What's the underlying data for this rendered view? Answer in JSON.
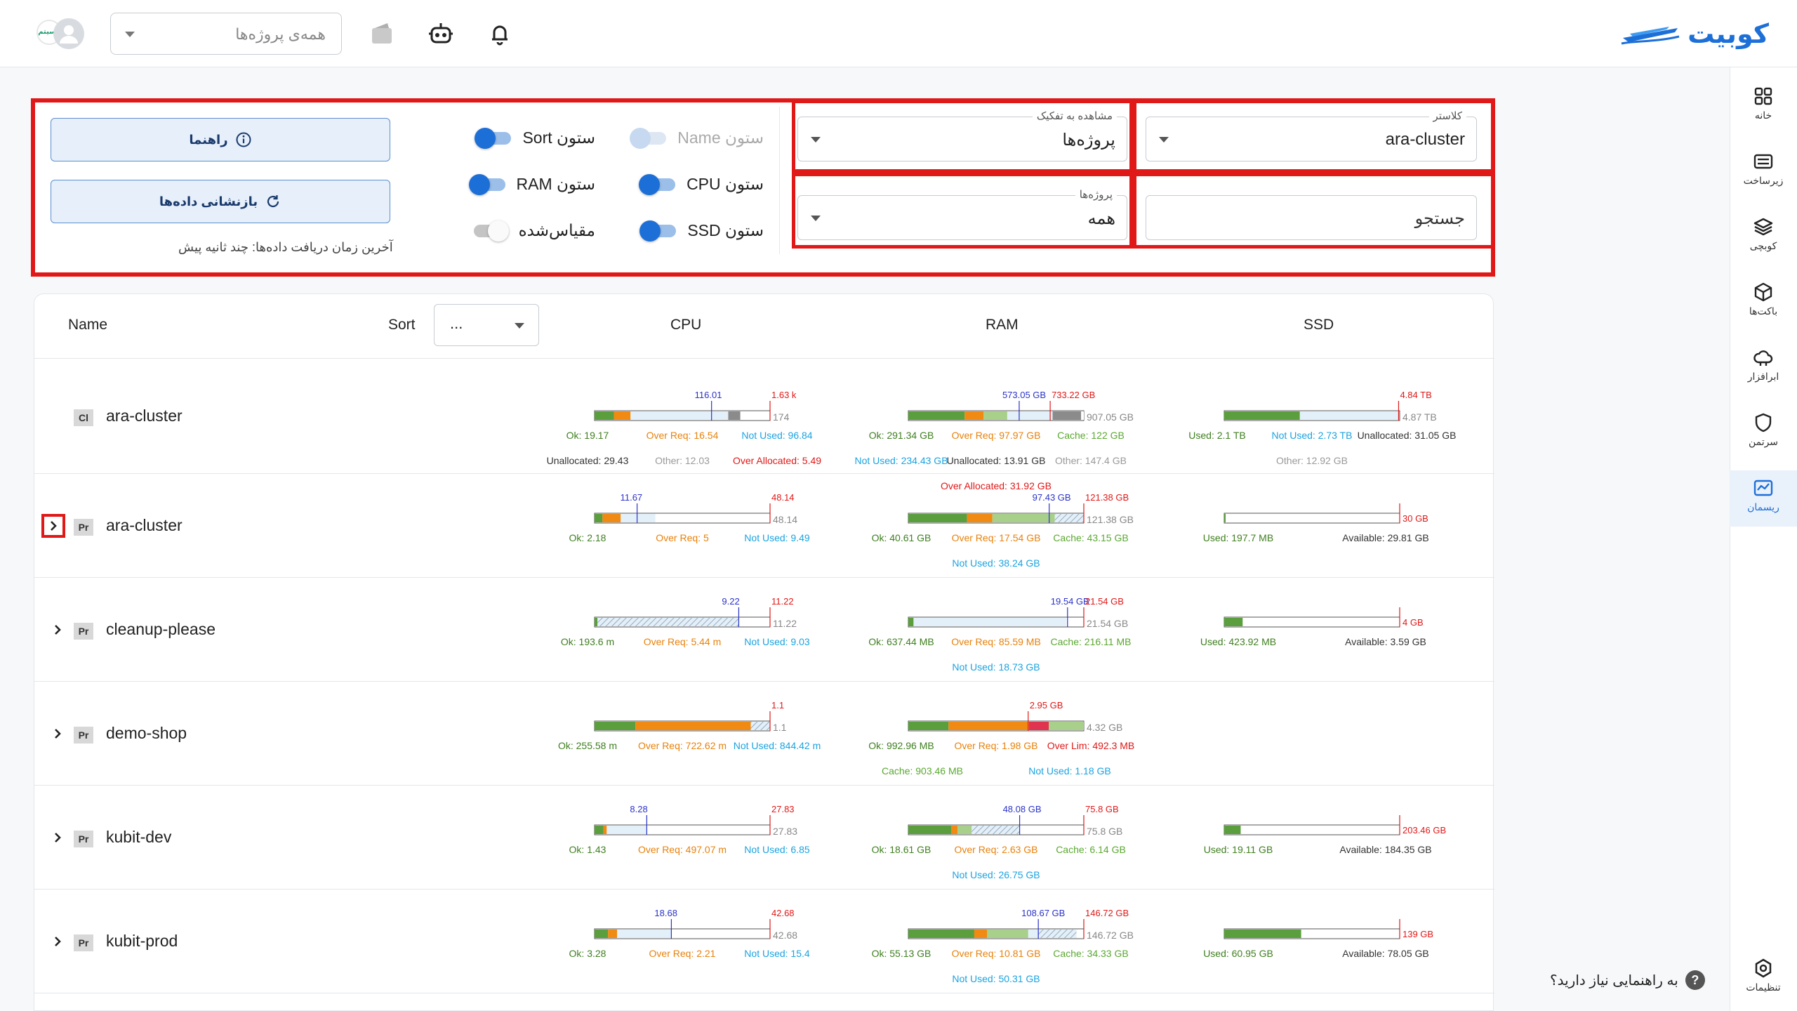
{
  "app": {
    "logo_text": "کوبیت",
    "project_select_placeholder": "همه‌ی پروژه‌ها",
    "avatar_brand": "رسیتم"
  },
  "sidenav": [
    {
      "label": "خانه",
      "icon": "grid-icon"
    },
    {
      "label": "زیرساخت",
      "icon": "server-icon"
    },
    {
      "label": "کوبچی",
      "icon": "layers-icon"
    },
    {
      "label": "باکت‌ها",
      "icon": "box-icon"
    },
    {
      "label": "ابرافزار",
      "icon": "cloud-icon"
    },
    {
      "label": "سرتمن",
      "icon": "shield-icon"
    },
    {
      "label": "ریسمان",
      "icon": "chart-icon",
      "active": true
    }
  ],
  "settings_label": "تنظیمات",
  "help_text": "به راهنمایی نیاز دارید؟",
  "filters": {
    "cluster": {
      "label": "کلاستر",
      "value": "ara-cluster"
    },
    "breakdown": {
      "label": "مشاهده به تفکیک",
      "value": "پروژه‌ها"
    },
    "search": {
      "placeholder": "جستجو"
    },
    "projects": {
      "label": "پروژه‌ها",
      "value": "همه"
    }
  },
  "toggles": [
    {
      "label": "ستون Name",
      "on": true,
      "disabled": true
    },
    {
      "label": "ستون Sort",
      "on": true
    },
    {
      "label": "ستون CPU",
      "on": true
    },
    {
      "label": "ستون RAM",
      "on": true
    },
    {
      "label": "ستون SSD",
      "on": true
    },
    {
      "label": "مقیاس‌شده",
      "on": false
    }
  ],
  "buttons": {
    "guide": "راهنما",
    "reset": "بازنشانی داده‌ها"
  },
  "last_fetch": "آخرین زمان دریافت داده‌ها: چند ثانیه پیش",
  "table": {
    "headers": {
      "name": "Name",
      "sort": "Sort",
      "cpu": "CPU",
      "ram": "RAM",
      "ssd": "SSD"
    },
    "sort_value": "...",
    "rows": [
      {
        "badge": "Cl",
        "name": "ara-cluster",
        "expandable": false,
        "cpu": {
          "capacity": 174,
          "marker": {
            "label": "116.01",
            "value": 116.01
          },
          "limit": {
            "label": "1.63 k"
          },
          "segments": [
            {
              "kind": "ok",
              "value": 19.17
            },
            {
              "kind": "over",
              "value": 16.54
            },
            {
              "kind": "notused",
              "value": 96.84
            },
            {
              "kind": "other",
              "value": 12.03
            },
            {
              "kind": "unalloc",
              "value": 29.43
            }
          ],
          "end_label": "174",
          "labels": [
            [
              "Ok: 19.17",
              "Over Req: 16.54",
              "Not Used: 96.84"
            ],
            [
              "Unallocated: 29.43",
              "Other: 12.03",
              "Over Allocated: 5.49"
            ]
          ]
        },
        "ram": {
          "capacity": 907.05,
          "marker": {
            "label": "573.05 GB",
            "value": 573.05
          },
          "limit": {
            "label": "733.22 GB",
            "value": 733.22
          },
          "segments": [
            {
              "kind": "ok",
              "value": 291.34
            },
            {
              "kind": "over",
              "value": 97.97
            },
            {
              "kind": "cache",
              "value": 122
            },
            {
              "kind": "notused",
              "value": 234.43
            },
            {
              "kind": "other",
              "value": 147.4
            },
            {
              "kind": "unalloc",
              "value": 13.91
            }
          ],
          "end_label": "907.05 GB",
          "labels": [
            [
              "Ok: 291.34 GB",
              "Over Req: 97.97 GB",
              "Cache: 122 GB"
            ],
            [
              "Not Used: 234.43 GB",
              "Unallocated: 13.91 GB",
              "Other: 147.4 GB"
            ],
            [
              "Over Allocated: 31.92 GB"
            ]
          ]
        },
        "ssd": {
          "capacity": 4.87,
          "limit": {
            "label": "4.84 TB",
            "value": 4.84
          },
          "segments": [
            {
              "kind": "ok",
              "value": 2.1
            },
            {
              "kind": "notused",
              "value": 2.73
            }
          ],
          "end_label": "4.87 TB",
          "labels": [
            [
              "Used: 2.1 TB",
              "Not Used: 2.73 TB",
              "Unallocated: 31.05 GB"
            ],
            [
              "Other: 12.92 GB"
            ]
          ]
        }
      },
      {
        "badge": "Pr",
        "name": "ara-cluster",
        "expandable": true,
        "highlight": true,
        "cpu": {
          "capacity": 48.14,
          "marker": {
            "label": "11.67",
            "value": 11.67
          },
          "limit": {
            "label": "48.14",
            "value": 48.14
          },
          "segments": [
            {
              "kind": "ok",
              "value": 2.18
            },
            {
              "kind": "over",
              "value": 5
            },
            {
              "kind": "notused",
              "value": 9.49
            }
          ],
          "end_label": "48.14",
          "labels": [
            [
              "Ok: 2.18",
              "Over Req: 5",
              "Not Used: 9.49"
            ]
          ]
        },
        "ram": {
          "capacity": 121.38,
          "marker": {
            "label": "97.43 GB",
            "value": 97.43
          },
          "limit": {
            "label": "121.38 GB",
            "value": 121.38
          },
          "segments": [
            {
              "kind": "ok",
              "value": 40.61
            },
            {
              "kind": "over",
              "value": 17.54
            },
            {
              "kind": "cache",
              "value": 43.15
            },
            {
              "kind": "hatch",
              "value": 20.08
            }
          ],
          "end_label": "121.38 GB",
          "labels": [
            [
              "Ok: 40.61 GB",
              "Over Req: 17.54 GB",
              "Cache: 43.15 GB"
            ],
            [
              "Not Used: 38.24 GB"
            ]
          ]
        },
        "ssd": {
          "capacity": 30,
          "limit": {
            "label": "30 GB",
            "value": 30
          },
          "segments": [
            {
              "kind": "ok",
              "value": 0.19
            }
          ],
          "end_label": "",
          "labels": [
            [
              "Used: 197.7 MB",
              "Available: 29.81 GB"
            ]
          ]
        }
      },
      {
        "badge": "Pr",
        "name": "cleanup-please",
        "expandable": true,
        "cpu": {
          "capacity": 11.22,
          "marker": {
            "label": "9.22",
            "value": 9.22
          },
          "limit": {
            "label": "11.22",
            "value": 11.22
          },
          "segments": [
            {
              "kind": "ok",
              "value": 0.19
            },
            {
              "kind": "hatch",
              "value": 9.03
            }
          ],
          "end_label": "11.22",
          "labels": [
            [
              "Ok: 193.6 m",
              "Over Req: 5.44 m",
              "Not Used: 9.03"
            ]
          ]
        },
        "ram": {
          "capacity": 21.54,
          "marker": {
            "label": "19.54 GB",
            "value": 19.54
          },
          "limit": {
            "label": "21.54 GB",
            "value": 21.54
          },
          "segments": [
            {
              "kind": "ok",
              "value": 0.64
            },
            {
              "kind": "notused",
              "value": 18.73
            }
          ],
          "end_label": "21.54 GB",
          "labels": [
            [
              "Ok: 637.44 MB",
              "Over Req: 85.59 MB",
              "Cache: 216.11 MB"
            ],
            [
              "Not Used: 18.73 GB"
            ]
          ]
        },
        "ssd": {
          "capacity": 4,
          "limit": {
            "label": "4 GB",
            "value": 4
          },
          "segments": [
            {
              "kind": "ok",
              "value": 0.42
            }
          ],
          "end_label": "",
          "labels": [
            [
              "Used: 423.92 MB",
              "Available: 3.59 GB"
            ]
          ]
        }
      },
      {
        "badge": "Pr",
        "name": "demo-shop",
        "expandable": true,
        "cpu": {
          "capacity": 1.1,
          "limit": {
            "label": "1.1",
            "value": 1.1
          },
          "segments": [
            {
              "kind": "ok",
              "value": 0.256
            },
            {
              "kind": "over",
              "value": 0.723
            },
            {
              "kind": "hatch",
              "value": 0.12
            }
          ],
          "end_label": "1.1",
          "labels": [
            [
              "Ok: 255.58 m",
              "Over Req: 722.62 m",
              "Not Used: 844.42 m"
            ]
          ]
        },
        "ram": {
          "capacity": 4.32,
          "limit": {
            "label": "2.95 GB",
            "value": 2.95
          },
          "segments": [
            {
              "kind": "ok",
              "value": 0.99
            },
            {
              "kind": "over",
              "value": 1.98
            },
            {
              "kind": "overlim",
              "value": 0.49
            },
            {
              "kind": "cache",
              "value": 0.86
            }
          ],
          "end_label": "4.32 GB",
          "labels": [
            [
              "Ok: 992.96 MB",
              "Over Req: 1.98 GB",
              "Over Lim: 492.3 MB"
            ],
            [
              "Cache: 903.46 MB",
              "Not Used: 1.18 GB"
            ]
          ]
        },
        "ssd": null
      },
      {
        "badge": "Pr",
        "name": "kubit-dev",
        "expandable": true,
        "cpu": {
          "capacity": 27.83,
          "marker": {
            "label": "8.28",
            "value": 8.28
          },
          "limit": {
            "label": "27.83",
            "value": 27.83
          },
          "segments": [
            {
              "kind": "ok",
              "value": 1.43
            },
            {
              "kind": "over",
              "value": 0.5
            },
            {
              "kind": "notused",
              "value": 6.35
            }
          ],
          "end_label": "27.83",
          "labels": [
            [
              "Ok: 1.43",
              "Over Req: 497.07 m",
              "Not Used: 6.85"
            ]
          ]
        },
        "ram": {
          "capacity": 75.8,
          "marker": {
            "label": "48.08 GB",
            "value": 48.08
          },
          "limit": {
            "label": "75.8 GB",
            "value": 75.8
          },
          "segments": [
            {
              "kind": "ok",
              "value": 18.61
            },
            {
              "kind": "over",
              "value": 2.63
            },
            {
              "kind": "cache",
              "value": 6.14
            },
            {
              "kind": "hatch",
              "value": 20.7
            }
          ],
          "end_label": "75.8 GB",
          "labels": [
            [
              "Ok: 18.61 GB",
              "Over Req: 2.63 GB",
              "Cache: 6.14 GB"
            ],
            [
              "Not Used: 26.75 GB"
            ]
          ]
        },
        "ssd": {
          "capacity": 203.46,
          "limit": {
            "label": "203.46 GB",
            "value": 203.46
          },
          "segments": [
            {
              "kind": "ok",
              "value": 19.11
            }
          ],
          "end_label": "",
          "labels": [
            [
              "Used: 19.11 GB",
              "Available: 184.35 GB"
            ]
          ]
        }
      },
      {
        "badge": "Pr",
        "name": "kubit-prod",
        "expandable": true,
        "cpu": {
          "capacity": 42.68,
          "marker": {
            "label": "18.68",
            "value": 18.68
          },
          "limit": {
            "label": "42.68",
            "value": 42.68
          },
          "segments": [
            {
              "kind": "ok",
              "value": 3.28
            },
            {
              "kind": "over",
              "value": 2.21
            },
            {
              "kind": "notused",
              "value": 13.19
            }
          ],
          "end_label": "42.68",
          "labels": [
            [
              "Ok: 3.28",
              "Over Req: 2.21",
              "Not Used: 15.4"
            ]
          ]
        },
        "ram": {
          "capacity": 146.72,
          "marker": {
            "label": "108.67 GB",
            "value": 108.67
          },
          "limit": {
            "label": "146.72 GB",
            "value": 146.72
          },
          "segments": [
            {
              "kind": "ok",
              "value": 55.13
            },
            {
              "kind": "over",
              "value": 10.81
            },
            {
              "kind": "cache",
              "value": 34.33
            },
            {
              "kind": "notused",
              "value": 8.4
            },
            {
              "kind": "hatch",
              "value": 31.9
            }
          ],
          "end_label": "146.72 GB",
          "labels": [
            [
              "Ok: 55.13 GB",
              "Over Req: 10.81 GB",
              "Cache: 34.33 GB"
            ],
            [
              "Not Used: 50.31 GB"
            ]
          ]
        },
        "ssd": {
          "capacity": 139,
          "limit": {
            "label": "139 GB",
            "value": 139
          },
          "segments": [
            {
              "kind": "ok",
              "value": 60.95
            }
          ],
          "end_label": "",
          "labels": [
            [
              "Used: 60.95 GB",
              "Available: 78.05 GB"
            ]
          ]
        }
      }
    ]
  },
  "colors": {
    "ok": "#5a9e3e",
    "over": "#f08a12",
    "cache": "#a8d08a",
    "notused": "#e3f0fa",
    "other": "#8b8b8b",
    "unalloc": "#ffffff",
    "overlim": "#e0334f",
    "limit": "#e01818",
    "marker": "#2a33c8",
    "label_ok": "#3f7f1f",
    "label_over": "#e8810a",
    "label_notused": "#1aa3e0",
    "label_other": "#999999",
    "label_red": "#e01818",
    "label_grey": "#333333"
  }
}
